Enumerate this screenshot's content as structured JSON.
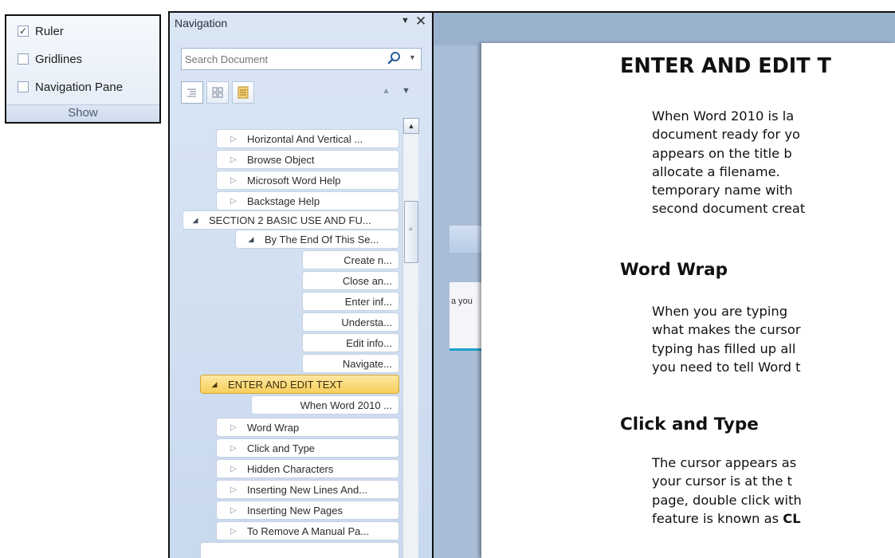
{
  "show_group": {
    "items": [
      {
        "label": "Ruler",
        "checked": true
      },
      {
        "label": "Gridlines",
        "checked": false
      },
      {
        "label": "Navigation Pane",
        "checked": false
      }
    ],
    "caption": "Show"
  },
  "nav": {
    "title": "Navigation",
    "close": "✕",
    "menu_arrow": "▼",
    "search_placeholder": "Search Document",
    "tree": [
      {
        "label": "Horizontal And Vertical ...",
        "expander": "collapsed"
      },
      {
        "label": "Browse Object",
        "expander": "collapsed"
      },
      {
        "label": "Microsoft Word Help",
        "expander": "collapsed"
      },
      {
        "label": "Backstage Help",
        "expander": "collapsed"
      },
      {
        "label": "SECTION 2 BASIC USE AND FU...",
        "expander": "expanded"
      },
      {
        "label": "By The End Of This Se...",
        "expander": "expanded"
      },
      {
        "label": "Create n...",
        "expander": "none"
      },
      {
        "label": "Close an...",
        "expander": "none"
      },
      {
        "label": "Enter inf...",
        "expander": "none"
      },
      {
        "label": "Understa...",
        "expander": "none"
      },
      {
        "label": "Edit info...",
        "expander": "none"
      },
      {
        "label": "Navigate...",
        "expander": "none"
      },
      {
        "label": "ENTER AND EDIT TEXT",
        "expander": "expanded",
        "selected": true
      },
      {
        "label": "When Word 2010 ...",
        "expander": "none"
      },
      {
        "label": "Word Wrap",
        "expander": "collapsed"
      },
      {
        "label": "Click and Type",
        "expander": "collapsed"
      },
      {
        "label": "Hidden Characters",
        "expander": "collapsed"
      },
      {
        "label": "Inserting New Lines And...",
        "expander": "collapsed"
      },
      {
        "label": "Inserting New Pages",
        "expander": "collapsed"
      },
      {
        "label": "To Remove A Manual Pa...",
        "expander": "collapsed"
      }
    ]
  },
  "behind_window": {
    "text": "a you"
  },
  "document": {
    "heading": "ENTER AND EDIT T",
    "intro_lines": [
      "When Word 2010 is la",
      "document ready for yo",
      "appears on the title b",
      "allocate a filename.",
      "temporary name with",
      "second document creat"
    ],
    "word_wrap_heading": "Word Wrap",
    "word_wrap_lines": [
      "When you are typing",
      "what makes the cursor",
      "typing has filled up all",
      "you need to tell Word t"
    ],
    "click_type_heading": "Click and Type",
    "click_type_lines": [
      "The cursor appears as",
      "your cursor is at the t",
      "page, double click with",
      "feature is known as "
    ],
    "click_type_bold_tail": "CL"
  },
  "colors": {
    "selected_node": "#f8cf5c",
    "pane_bg": "#c9d9ee",
    "doc_bg": "#9bb2cf"
  }
}
